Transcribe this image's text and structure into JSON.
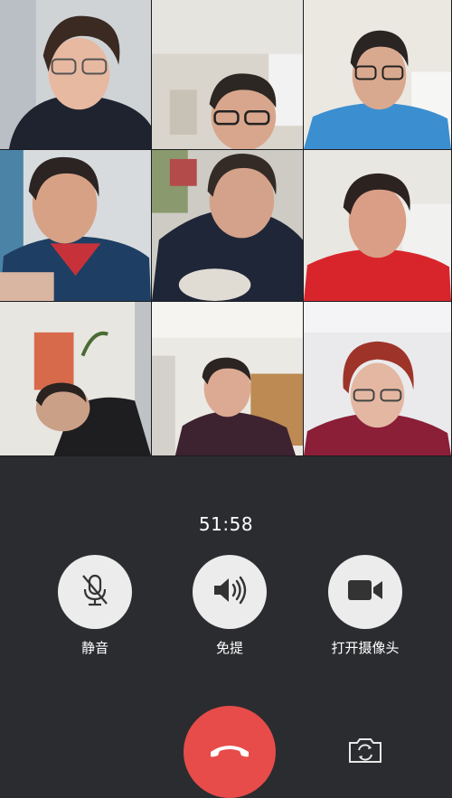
{
  "call": {
    "duration": "51:58"
  },
  "controls": {
    "mute_label": "静音",
    "speaker_label": "免提",
    "camera_label": "打开摄像头"
  },
  "participants": [
    {
      "tile": 1
    },
    {
      "tile": 2
    },
    {
      "tile": 3
    },
    {
      "tile": 4
    },
    {
      "tile": 5
    },
    {
      "tile": 6
    },
    {
      "tile": 7
    },
    {
      "tile": 8
    },
    {
      "tile": 9
    }
  ],
  "colors": {
    "background": "#2b2c2f",
    "control_button": "#ececec",
    "hangup": "#e74c4a",
    "text": "#ffffff"
  },
  "icons": {
    "mute": "mic-off-icon",
    "speaker": "speaker-icon",
    "camera": "video-camera-icon",
    "hangup": "phone-hangup-icon",
    "flip": "camera-flip-icon"
  }
}
